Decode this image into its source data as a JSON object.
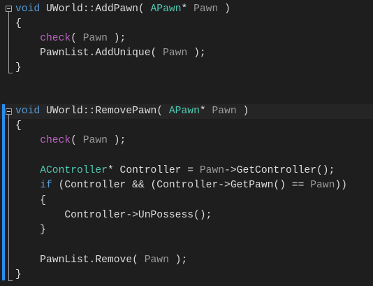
{
  "editor": {
    "colors": {
      "background": "#1e1e1e",
      "keyword": "#569cd6",
      "type": "#4ec9b0",
      "parameter": "#9a9a9a",
      "macro": "#bd63c5",
      "text": "#dcdcdc",
      "change_bar": "#2d8ceb"
    },
    "lines": [
      {
        "row": 0,
        "tokens": [
          [
            "void ",
            "kw"
          ],
          [
            "UWorld::AddPawn( ",
            "tx"
          ],
          [
            "APawn",
            "ty"
          ],
          [
            "* ",
            "tx"
          ],
          [
            "Pawn",
            "pa"
          ],
          [
            " )",
            "tx"
          ]
        ]
      },
      {
        "row": 1,
        "tokens": [
          [
            "{",
            "tx"
          ]
        ]
      },
      {
        "row": 2,
        "tokens": [
          [
            "    ",
            "tx"
          ],
          [
            "check",
            "mac"
          ],
          [
            "( ",
            "tx"
          ],
          [
            "Pawn",
            "pa"
          ],
          [
            " );",
            "tx"
          ]
        ]
      },
      {
        "row": 3,
        "tokens": [
          [
            "    PawnList.AddUnique( ",
            "tx"
          ],
          [
            "Pawn",
            "pa"
          ],
          [
            " );",
            "tx"
          ]
        ]
      },
      {
        "row": 4,
        "tokens": [
          [
            "}",
            "tx"
          ]
        ]
      },
      {
        "row": 7,
        "tokens": [
          [
            "void ",
            "kw"
          ],
          [
            "UWorld::RemovePawn( ",
            "tx"
          ],
          [
            "APawn",
            "ty"
          ],
          [
            "* ",
            "tx"
          ],
          [
            "Pawn",
            "pa"
          ],
          [
            " )",
            "tx"
          ]
        ]
      },
      {
        "row": 8,
        "tokens": [
          [
            "{",
            "tx"
          ]
        ]
      },
      {
        "row": 9,
        "tokens": [
          [
            "    ",
            "tx"
          ],
          [
            "check",
            "mac"
          ],
          [
            "( ",
            "tx"
          ],
          [
            "Pawn",
            "pa"
          ],
          [
            " );",
            "tx"
          ]
        ]
      },
      {
        "row": 11,
        "tokens": [
          [
            "    ",
            "tx"
          ],
          [
            "AController",
            "ty"
          ],
          [
            "* Controller = ",
            "tx"
          ],
          [
            "Pawn",
            "pa"
          ],
          [
            "->GetController();",
            "tx"
          ]
        ]
      },
      {
        "row": 12,
        "tokens": [
          [
            "    ",
            "tx"
          ],
          [
            "if",
            "kw"
          ],
          [
            " (Controller && (Controller->GetPawn() == ",
            "tx"
          ],
          [
            "Pawn",
            "pa"
          ],
          [
            "))",
            "tx"
          ]
        ]
      },
      {
        "row": 13,
        "tokens": [
          [
            "    {",
            "tx"
          ]
        ]
      },
      {
        "row": 14,
        "tokens": [
          [
            "        Controller->UnPossess();",
            "tx"
          ]
        ]
      },
      {
        "row": 15,
        "tokens": [
          [
            "    }",
            "tx"
          ]
        ]
      },
      {
        "row": 17,
        "tokens": [
          [
            "    PawnList.Remove( ",
            "tx"
          ],
          [
            "Pawn",
            "pa"
          ],
          [
            " );",
            "tx"
          ]
        ]
      },
      {
        "row": 18,
        "tokens": [
          [
            "}",
            "tx"
          ]
        ]
      }
    ]
  }
}
